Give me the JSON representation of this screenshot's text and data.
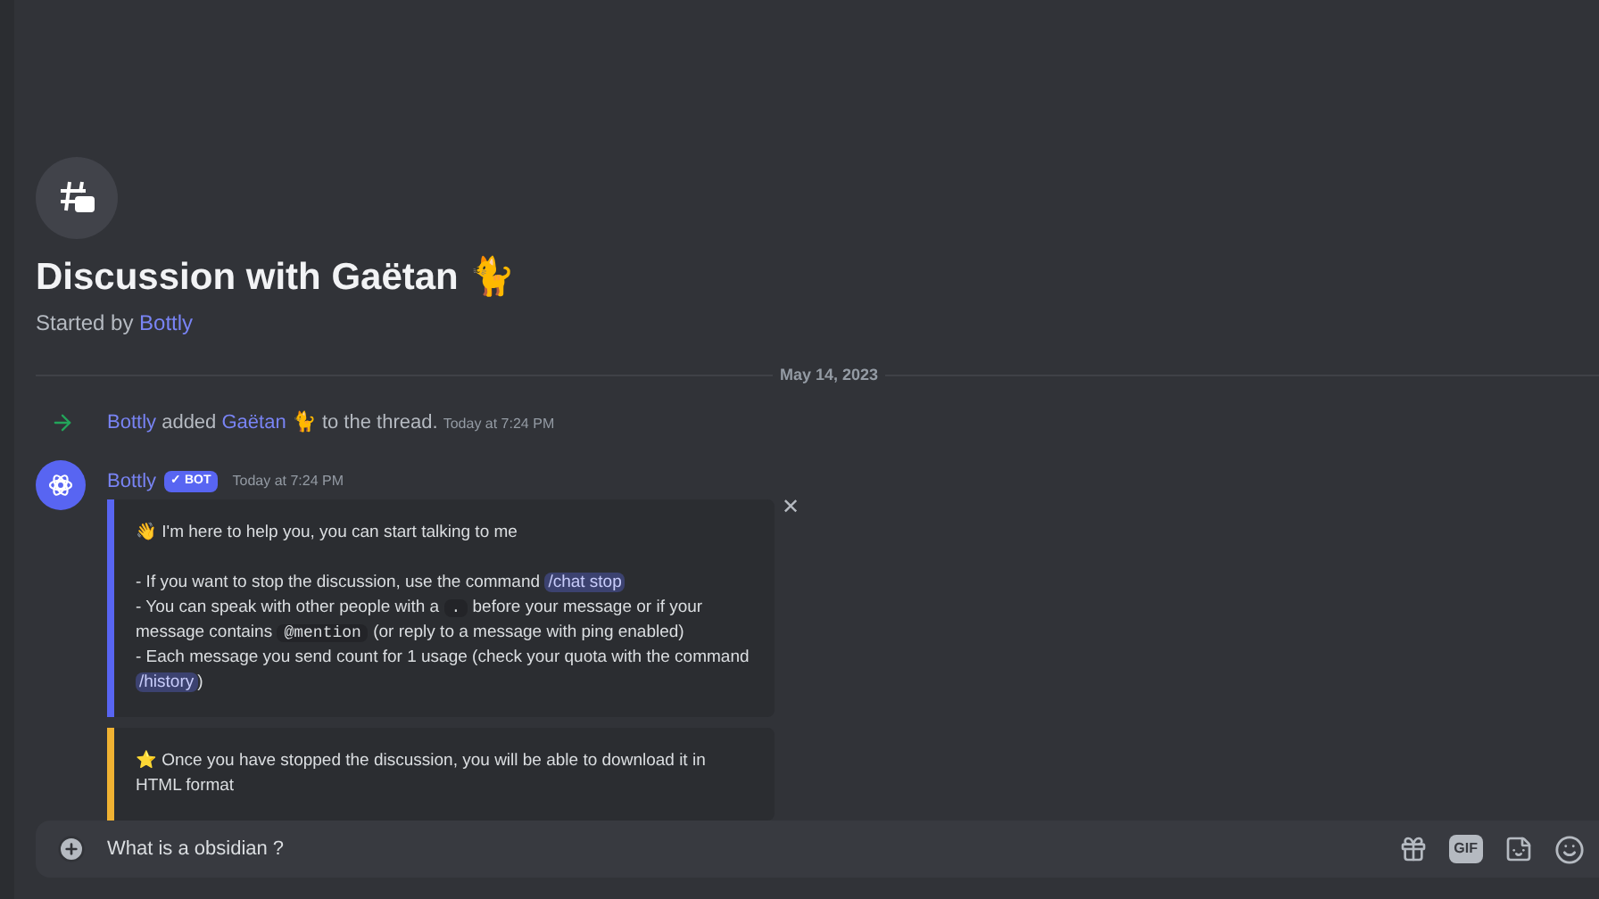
{
  "thread": {
    "title": "Discussion with Gaëtan",
    "title_emoji": "🐈",
    "started_by_label": "Started by",
    "started_by": "Bottly"
  },
  "date_divider": "May 14, 2023",
  "system_message": {
    "actor": "Bottly",
    "verb": "added",
    "target": "Gaëtan",
    "target_emoji": "🐈",
    "rest": "to the thread.",
    "time": "Today at 7:24 PM"
  },
  "message": {
    "author": "Bottly",
    "badge": "✓ BOT",
    "time": "Today at 7:24 PM",
    "close": "✕",
    "embeds": [
      {
        "color": "#5865f2",
        "lines": [
          [
            {
              "kind": "emoji",
              "text": "👋"
            },
            {
              "kind": "text",
              "text": " I'm here to help you, you can start talking to me"
            }
          ],
          [
            {
              "kind": "break"
            },
            {
              "kind": "text",
              "text": "- If you want to stop the discussion, use the command "
            },
            {
              "kind": "command",
              "text": "/chat stop"
            }
          ],
          [
            {
              "kind": "text",
              "text": "- You can speak with other people with a "
            },
            {
              "kind": "code",
              "text": "."
            },
            {
              "kind": "text",
              "text": " before your message or if your message contains "
            },
            {
              "kind": "code",
              "text": "@mention"
            },
            {
              "kind": "text",
              "text": " (or reply to a message with ping enabled)"
            }
          ],
          [
            {
              "kind": "text",
              "text": "- Each message you send count for 1 usage (check your quota with the command "
            },
            {
              "kind": "command",
              "text": "/history"
            },
            {
              "kind": "text",
              "text": ")"
            }
          ]
        ]
      },
      {
        "color": "#f0b232",
        "lines": [
          [
            {
              "kind": "emoji",
              "text": "⭐"
            },
            {
              "kind": "text",
              "text": " Once you have stopped the discussion, you will be able to download it in HTML format"
            }
          ]
        ]
      }
    ]
  },
  "composer": {
    "value": "What is a obsidian ?",
    "gif_label": "GIF"
  }
}
